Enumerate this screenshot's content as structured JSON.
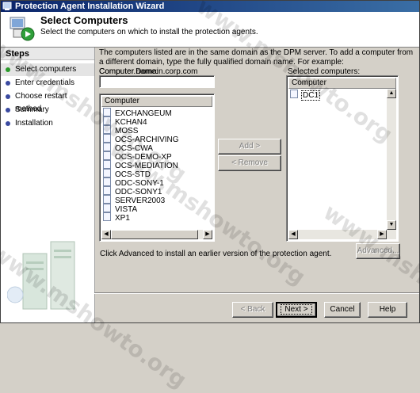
{
  "window": {
    "title": "Protection Agent Installation Wizard"
  },
  "header": {
    "title": "Select Computers",
    "subtitle": "Select the computers on which to install the protection agents."
  },
  "steps": {
    "title": "Steps",
    "items": [
      {
        "label": "Select computers",
        "active": true
      },
      {
        "label": "Enter credentials",
        "active": false
      },
      {
        "label": "Choose restart method",
        "active": false
      },
      {
        "label": "Summary",
        "active": false
      },
      {
        "label": "Installation",
        "active": false
      }
    ]
  },
  "main": {
    "description": "The computers listed are in the same domain as the DPM server. To add a computer from a different domain, type the fully qualified domain name. For example: Computer.Domain.corp.com",
    "computer_name_label": "Computer name:",
    "computer_name_value": "",
    "available_list": {
      "column": "Computer",
      "items": [
        "EXCHANGEUM",
        "KCHAN4",
        "MOSS",
        "OCS-ARCHIVING",
        "OCS-CWA",
        "OCS-DEMO-XP",
        "OCS-MEDIATION",
        "OCS-STD",
        "ODC-SONY-1",
        "ODC-SONY1",
        "SERVER2003",
        "VISTA",
        "XP1"
      ]
    },
    "selected_label": "Selected computers:",
    "selected_list": {
      "column": "Computer",
      "items": [
        "DC1"
      ]
    },
    "add_button": "Add >",
    "remove_button": "< Remove",
    "advanced_note": "Click Advanced to install an earlier version of the protection agent.",
    "advanced_button": "Advanced..."
  },
  "footer": {
    "back_button": "< Back",
    "next_button": "Next >",
    "cancel_button": "Cancel",
    "help_button": "Help"
  },
  "watermark": {
    "text": "www.mshowto.org"
  },
  "colors": {
    "titlebar_start": "#0a246a",
    "titlebar_end": "#3a6ea5",
    "active_step_bullet": "#2a9a2a",
    "step_bullet": "#3a4aa0"
  }
}
